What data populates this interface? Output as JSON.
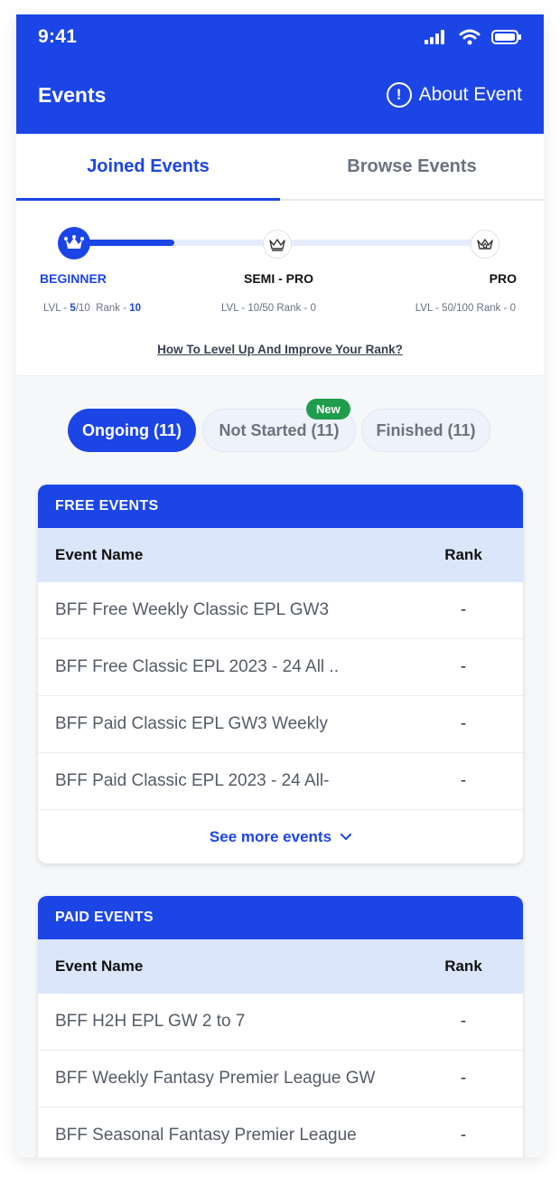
{
  "status_bar": {
    "time": "9:41"
  },
  "header": {
    "title": "Events",
    "about_label": "About Event",
    "about_icon": "!"
  },
  "tabs": [
    {
      "label": "Joined Events",
      "active": true
    },
    {
      "label": "Browse Events",
      "active": false
    }
  ],
  "levels": {
    "progress_fraction": 0.5,
    "items": [
      {
        "name": "BEGINNER",
        "lvl_prefix": "LVL - ",
        "lvl_current": "5",
        "lvl_total": "/10",
        "rank_prefix": "Rank - ",
        "rank": "10"
      },
      {
        "name": "SEMI - PRO",
        "meta": "LVL - 10/50  Rank - 0"
      },
      {
        "name": "PRO",
        "meta": "LVL - 50/100  Rank - 0"
      }
    ],
    "help_link": "How To Level Up And Improve Your Rank?"
  },
  "filters": {
    "ongoing": "Ongoing (11)",
    "not_started": "Not Started (11)",
    "finished": "Finished (11)",
    "new_badge": "New"
  },
  "free_events": {
    "title": "FREE EVENTS",
    "col_name": "Event Name",
    "col_rank": "Rank",
    "rows": [
      {
        "name": "BFF Free Weekly Classic EPL GW3",
        "rank": "-"
      },
      {
        "name": "BFF Free Classic EPL 2023 - 24 All ..",
        "rank": "-"
      },
      {
        "name": "BFF Paid Classic EPL GW3 Weekly",
        "rank": "-"
      },
      {
        "name": "BFF Paid Classic EPL 2023 - 24 All-",
        "rank": "-"
      }
    ],
    "see_more": "See more events"
  },
  "paid_events": {
    "title": "PAID EVENTS",
    "col_name": "Event Name",
    "col_rank": "Rank",
    "rows": [
      {
        "name": "BFF H2H EPL GW 2 to 7",
        "rank": "-"
      },
      {
        "name": "BFF Weekly Fantasy Premier League GW",
        "rank": "-"
      },
      {
        "name": "BFF Seasonal Fantasy Premier League",
        "rank": "-"
      }
    ]
  },
  "colors": {
    "accent": "#1c45e6",
    "badge": "#1f9d4d",
    "table_head": "#dbe6fb"
  }
}
